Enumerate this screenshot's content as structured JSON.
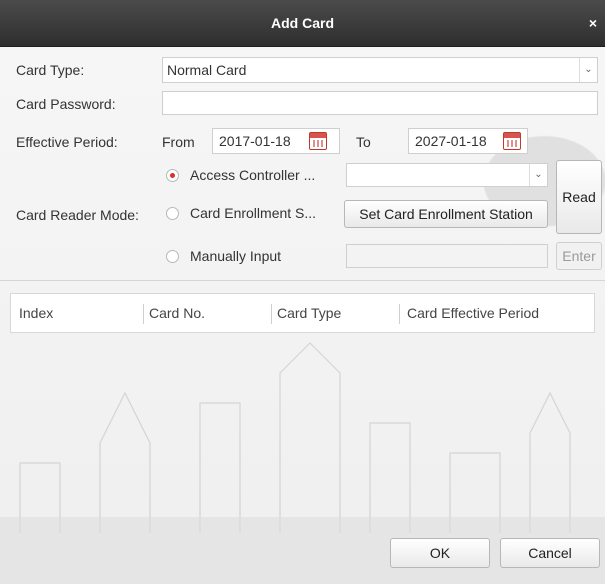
{
  "dialog": {
    "title": "Add Card",
    "close_glyph": "×"
  },
  "form": {
    "card_type_label": "Card Type:",
    "card_type_value": "Normal Card",
    "card_password_label": "Card Password:",
    "card_password_value": "",
    "effective_period_label": "Effective Period:",
    "from_label": "From",
    "from_value": "2017-01-18",
    "to_label": "To",
    "to_value": "2027-01-18",
    "card_reader_mode_label": "Card Reader Mode:",
    "modes": [
      {
        "label": "Access Controller ...",
        "selected": true
      },
      {
        "label": "Card Enrollment S...",
        "selected": false
      },
      {
        "label": "Manually Input",
        "selected": false
      }
    ],
    "access_controller_value": "",
    "set_station_button": "Set Card Enrollment Station",
    "read_button": "Read",
    "enter_button": "Enter",
    "manual_input_value": ""
  },
  "table": {
    "columns": [
      "Index",
      "Card No.",
      "Card Type",
      "Card Effective Period"
    ],
    "rows": []
  },
  "footer": {
    "ok_button": "OK",
    "cancel_button": "Cancel"
  },
  "colors": {
    "titlebar": "#3a3a3a",
    "radio_selected": "#d9302a",
    "calendar_icon": "#d9534f"
  },
  "icons": {
    "calendar": "calendar-icon",
    "dropdown": "chevron-down-icon",
    "close": "close-icon"
  }
}
